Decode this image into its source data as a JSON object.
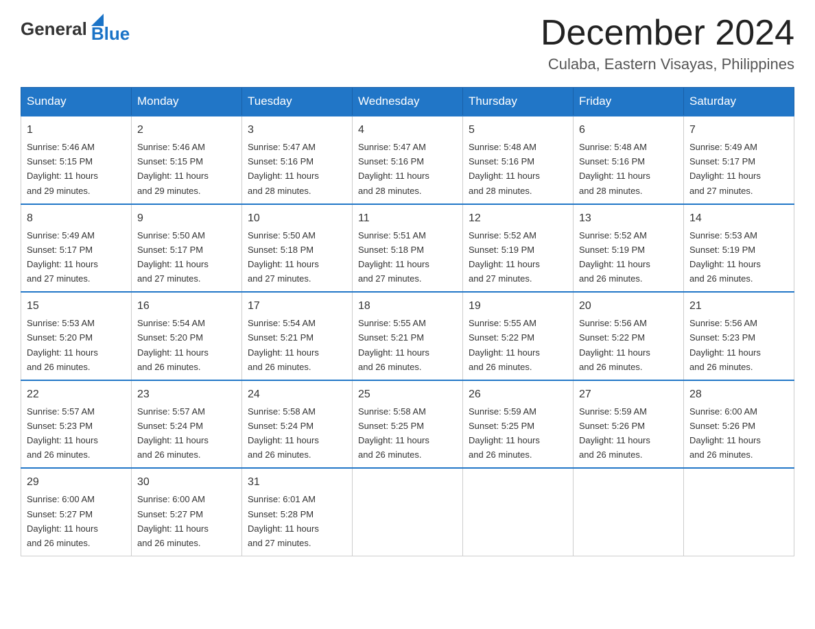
{
  "header": {
    "logo_general": "General",
    "logo_blue": "Blue",
    "month_title": "December 2024",
    "location": "Culaba, Eastern Visayas, Philippines"
  },
  "weekdays": [
    "Sunday",
    "Monday",
    "Tuesday",
    "Wednesday",
    "Thursday",
    "Friday",
    "Saturday"
  ],
  "weeks": [
    [
      {
        "day": "1",
        "sunrise": "5:46 AM",
        "sunset": "5:15 PM",
        "daylight": "11 hours and 29 minutes."
      },
      {
        "day": "2",
        "sunrise": "5:46 AM",
        "sunset": "5:15 PM",
        "daylight": "11 hours and 29 minutes."
      },
      {
        "day": "3",
        "sunrise": "5:47 AM",
        "sunset": "5:16 PM",
        "daylight": "11 hours and 28 minutes."
      },
      {
        "day": "4",
        "sunrise": "5:47 AM",
        "sunset": "5:16 PM",
        "daylight": "11 hours and 28 minutes."
      },
      {
        "day": "5",
        "sunrise": "5:48 AM",
        "sunset": "5:16 PM",
        "daylight": "11 hours and 28 minutes."
      },
      {
        "day": "6",
        "sunrise": "5:48 AM",
        "sunset": "5:16 PM",
        "daylight": "11 hours and 28 minutes."
      },
      {
        "day": "7",
        "sunrise": "5:49 AM",
        "sunset": "5:17 PM",
        "daylight": "11 hours and 27 minutes."
      }
    ],
    [
      {
        "day": "8",
        "sunrise": "5:49 AM",
        "sunset": "5:17 PM",
        "daylight": "11 hours and 27 minutes."
      },
      {
        "day": "9",
        "sunrise": "5:50 AM",
        "sunset": "5:17 PM",
        "daylight": "11 hours and 27 minutes."
      },
      {
        "day": "10",
        "sunrise": "5:50 AM",
        "sunset": "5:18 PM",
        "daylight": "11 hours and 27 minutes."
      },
      {
        "day": "11",
        "sunrise": "5:51 AM",
        "sunset": "5:18 PM",
        "daylight": "11 hours and 27 minutes."
      },
      {
        "day": "12",
        "sunrise": "5:52 AM",
        "sunset": "5:19 PM",
        "daylight": "11 hours and 27 minutes."
      },
      {
        "day": "13",
        "sunrise": "5:52 AM",
        "sunset": "5:19 PM",
        "daylight": "11 hours and 26 minutes."
      },
      {
        "day": "14",
        "sunrise": "5:53 AM",
        "sunset": "5:19 PM",
        "daylight": "11 hours and 26 minutes."
      }
    ],
    [
      {
        "day": "15",
        "sunrise": "5:53 AM",
        "sunset": "5:20 PM",
        "daylight": "11 hours and 26 minutes."
      },
      {
        "day": "16",
        "sunrise": "5:54 AM",
        "sunset": "5:20 PM",
        "daylight": "11 hours and 26 minutes."
      },
      {
        "day": "17",
        "sunrise": "5:54 AM",
        "sunset": "5:21 PM",
        "daylight": "11 hours and 26 minutes."
      },
      {
        "day": "18",
        "sunrise": "5:55 AM",
        "sunset": "5:21 PM",
        "daylight": "11 hours and 26 minutes."
      },
      {
        "day": "19",
        "sunrise": "5:55 AM",
        "sunset": "5:22 PM",
        "daylight": "11 hours and 26 minutes."
      },
      {
        "day": "20",
        "sunrise": "5:56 AM",
        "sunset": "5:22 PM",
        "daylight": "11 hours and 26 minutes."
      },
      {
        "day": "21",
        "sunrise": "5:56 AM",
        "sunset": "5:23 PM",
        "daylight": "11 hours and 26 minutes."
      }
    ],
    [
      {
        "day": "22",
        "sunrise": "5:57 AM",
        "sunset": "5:23 PM",
        "daylight": "11 hours and 26 minutes."
      },
      {
        "day": "23",
        "sunrise": "5:57 AM",
        "sunset": "5:24 PM",
        "daylight": "11 hours and 26 minutes."
      },
      {
        "day": "24",
        "sunrise": "5:58 AM",
        "sunset": "5:24 PM",
        "daylight": "11 hours and 26 minutes."
      },
      {
        "day": "25",
        "sunrise": "5:58 AM",
        "sunset": "5:25 PM",
        "daylight": "11 hours and 26 minutes."
      },
      {
        "day": "26",
        "sunrise": "5:59 AM",
        "sunset": "5:25 PM",
        "daylight": "11 hours and 26 minutes."
      },
      {
        "day": "27",
        "sunrise": "5:59 AM",
        "sunset": "5:26 PM",
        "daylight": "11 hours and 26 minutes."
      },
      {
        "day": "28",
        "sunrise": "6:00 AM",
        "sunset": "5:26 PM",
        "daylight": "11 hours and 26 minutes."
      }
    ],
    [
      {
        "day": "29",
        "sunrise": "6:00 AM",
        "sunset": "5:27 PM",
        "daylight": "11 hours and 26 minutes."
      },
      {
        "day": "30",
        "sunrise": "6:00 AM",
        "sunset": "5:27 PM",
        "daylight": "11 hours and 26 minutes."
      },
      {
        "day": "31",
        "sunrise": "6:01 AM",
        "sunset": "5:28 PM",
        "daylight": "11 hours and 27 minutes."
      },
      null,
      null,
      null,
      null
    ]
  ]
}
